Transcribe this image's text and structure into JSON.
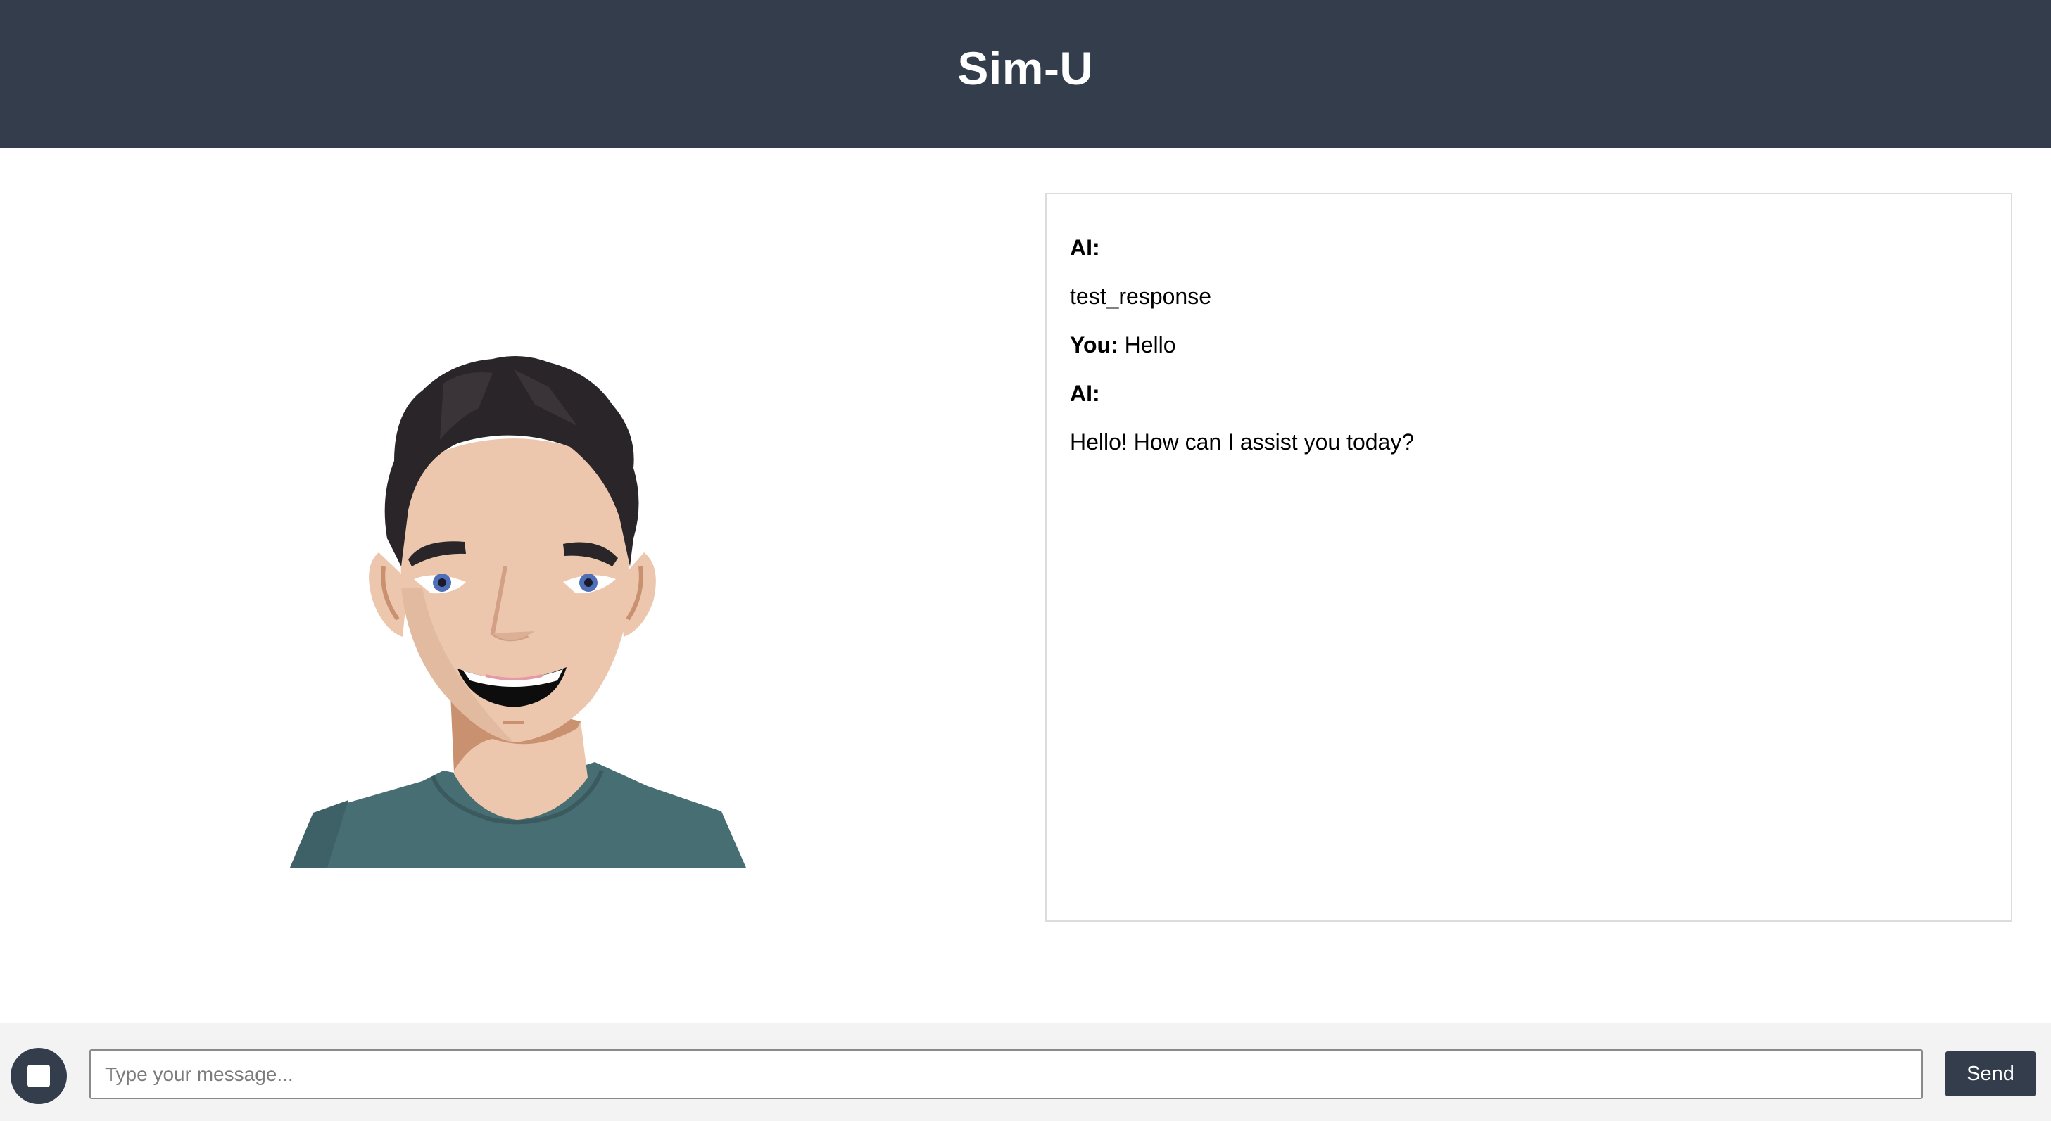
{
  "app": {
    "title": "Sim-U"
  },
  "avatar": {
    "icon": "smiling-man-avatar",
    "colors": {
      "hair": "#2a2529",
      "skin": "#ecc7ae",
      "skin_shadow": "#c99170",
      "shirt": "#476e73",
      "eyes": "#4f6fb8"
    }
  },
  "chat": {
    "messages": [
      {
        "sender": "AI:",
        "text": "test_response"
      },
      {
        "sender": "You:",
        "text": "Hello"
      },
      {
        "sender": "AI:",
        "text": "Hello! How can I assist you today?"
      }
    ]
  },
  "composer": {
    "stop_icon": "stop-icon",
    "placeholder": "Type your message...",
    "value": "",
    "send_label": "Send"
  },
  "theme": {
    "primary": "#333d4c",
    "footer_bg": "#f3f3f3",
    "panel_border": "#dcdcdc"
  }
}
